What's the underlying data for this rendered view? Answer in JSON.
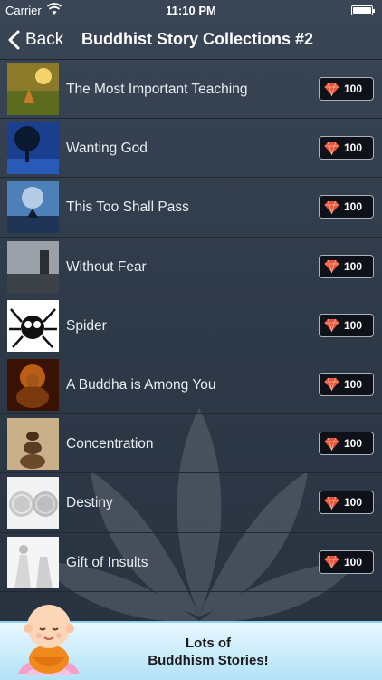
{
  "status_bar": {
    "carrier": "Carrier",
    "time": "11:10 PM"
  },
  "nav": {
    "back_label": "Back",
    "title": "Buddhist Story Collections #2"
  },
  "stories": [
    {
      "title": "The Most Important Teaching",
      "price": "100"
    },
    {
      "title": "Wanting God",
      "price": "100"
    },
    {
      "title": "This Too Shall Pass",
      "price": "100"
    },
    {
      "title": "Without Fear",
      "price": "100"
    },
    {
      "title": "Spider",
      "price": "100"
    },
    {
      "title": "A Buddha is Among You",
      "price": "100"
    },
    {
      "title": "Concentration",
      "price": "100"
    },
    {
      "title": "Destiny",
      "price": "100"
    },
    {
      "title": "Gift of Insults",
      "price": "100"
    }
  ],
  "banner": {
    "line1": "Lots of",
    "line2": "Buddhism Stories!"
  },
  "colors": {
    "background": "#2f3a49",
    "gem": "#e8543a",
    "banner": "#c9ecfb"
  },
  "icons": {
    "back": "chevron-left-icon",
    "price": "ruby-gem-icon",
    "wifi": "wifi-icon",
    "battery": "battery-icon"
  }
}
